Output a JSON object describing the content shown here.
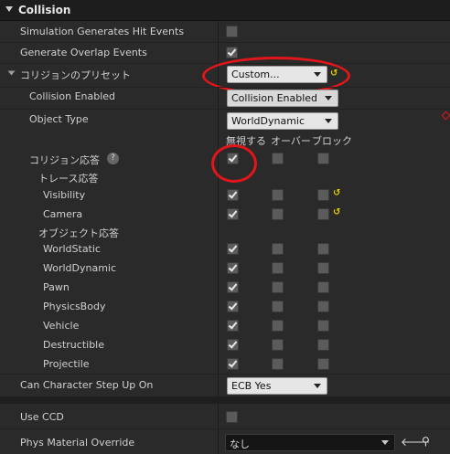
{
  "header": {
    "title": "Collision"
  },
  "rows": {
    "sim_hit": "Simulation Generates Hit Events",
    "gen_overlap": "Generate Overlap Events",
    "preset": "コリジョンのプリセット",
    "preset_value": "Custom...",
    "collision_enabled": "Collision Enabled",
    "collision_enabled_value": "Collision Enabled",
    "object_type": "Object Type",
    "object_type_value": "WorldDynamic",
    "col_ignore": "無視する",
    "col_overlap": "オーバー",
    "col_block": "ブロック",
    "collision_response": "コリジョン応答",
    "trace_response": "トレース応答",
    "object_response": "オブジェクト応答",
    "step_up": "Can Character Step Up On",
    "step_up_value": "ECB Yes",
    "use_ccd": "Use CCD",
    "phys_material": "Phys Material Override",
    "phys_material_value": "なし"
  },
  "trace_channels": [
    "Visibility",
    "Camera"
  ],
  "object_channels": [
    "WorldStatic",
    "WorldDynamic",
    "Pawn",
    "PhysicsBody",
    "Vehicle",
    "Destructible",
    "Projectile"
  ],
  "icons": {
    "reset": "reset-arrow-icon",
    "help": "question-icon",
    "use": "arrow-left-icon",
    "browse": "search-icon"
  },
  "colors": {
    "annotation": "#e0161b",
    "reset": "#e3d100"
  }
}
